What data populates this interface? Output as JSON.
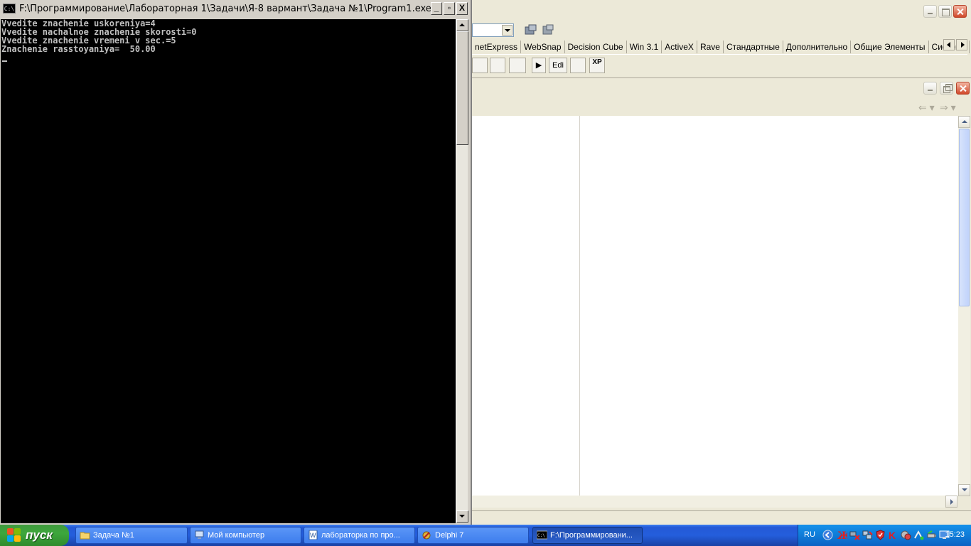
{
  "console": {
    "title": "F:\\Программирование\\Лабораторная 1\\Задачи\\Я-8 вармант\\Задача №1\\Program1.exe",
    "icon_text": "C:\\",
    "lines": [
      "Vvedite znachenie uskoreniya=4",
      "Vvedite nachalnoe znachenie skorosti=0",
      "Vvedite znachenie vremeni v sec.=5",
      "Znachenie rasstoyaniya=  50.00"
    ],
    "buttons": {
      "minimize": "_",
      "restore": "▫",
      "close": "X"
    }
  },
  "ide": {
    "palette_tabs": [
      "netExpress",
      "WebSnap",
      "Decision Cube",
      "Win 3.1",
      "ActiveX",
      "Rave",
      "Стандартные",
      "Дополнительно",
      "Общие Элементы",
      "Система"
    ],
    "component_labels": {
      "edit": "Edi",
      "xp": "XP"
    },
    "icons": {
      "toolbar_1": "open-project-icon",
      "toolbar_2": "save-icon",
      "nav_back": "back-arrow-icon",
      "nav_forward": "forward-arrow-icon"
    }
  },
  "taskbar": {
    "start_label": "пуск",
    "items": [
      {
        "label": "Задача №1",
        "icon": "folder-icon"
      },
      {
        "label": "Мой компьютер",
        "icon": "computer-icon"
      },
      {
        "label": "лабораторка по про...",
        "icon": "word-document-icon"
      },
      {
        "label": "Delphi 7",
        "icon": "delphi-icon"
      },
      {
        "label": "F:\\Программировани...",
        "icon": "console-icon",
        "active": true
      }
    ],
    "tray": {
      "language": "RU",
      "clock": "15:23",
      "icons": [
        "show-hidden-icon",
        "antivirus-icon",
        "network-disconnected-icon",
        "network-icon",
        "shield-icon",
        "kaspersky-icon",
        "security-icon",
        "connection-icon",
        "usb-icon",
        "monitor-icon"
      ]
    }
  },
  "colors": {
    "console_bg": "#000000",
    "console_text": "#c0c0c0",
    "taskbar_blue": "#245edc",
    "start_green": "#3da73c",
    "tray_blue": "#0f7cd8"
  }
}
